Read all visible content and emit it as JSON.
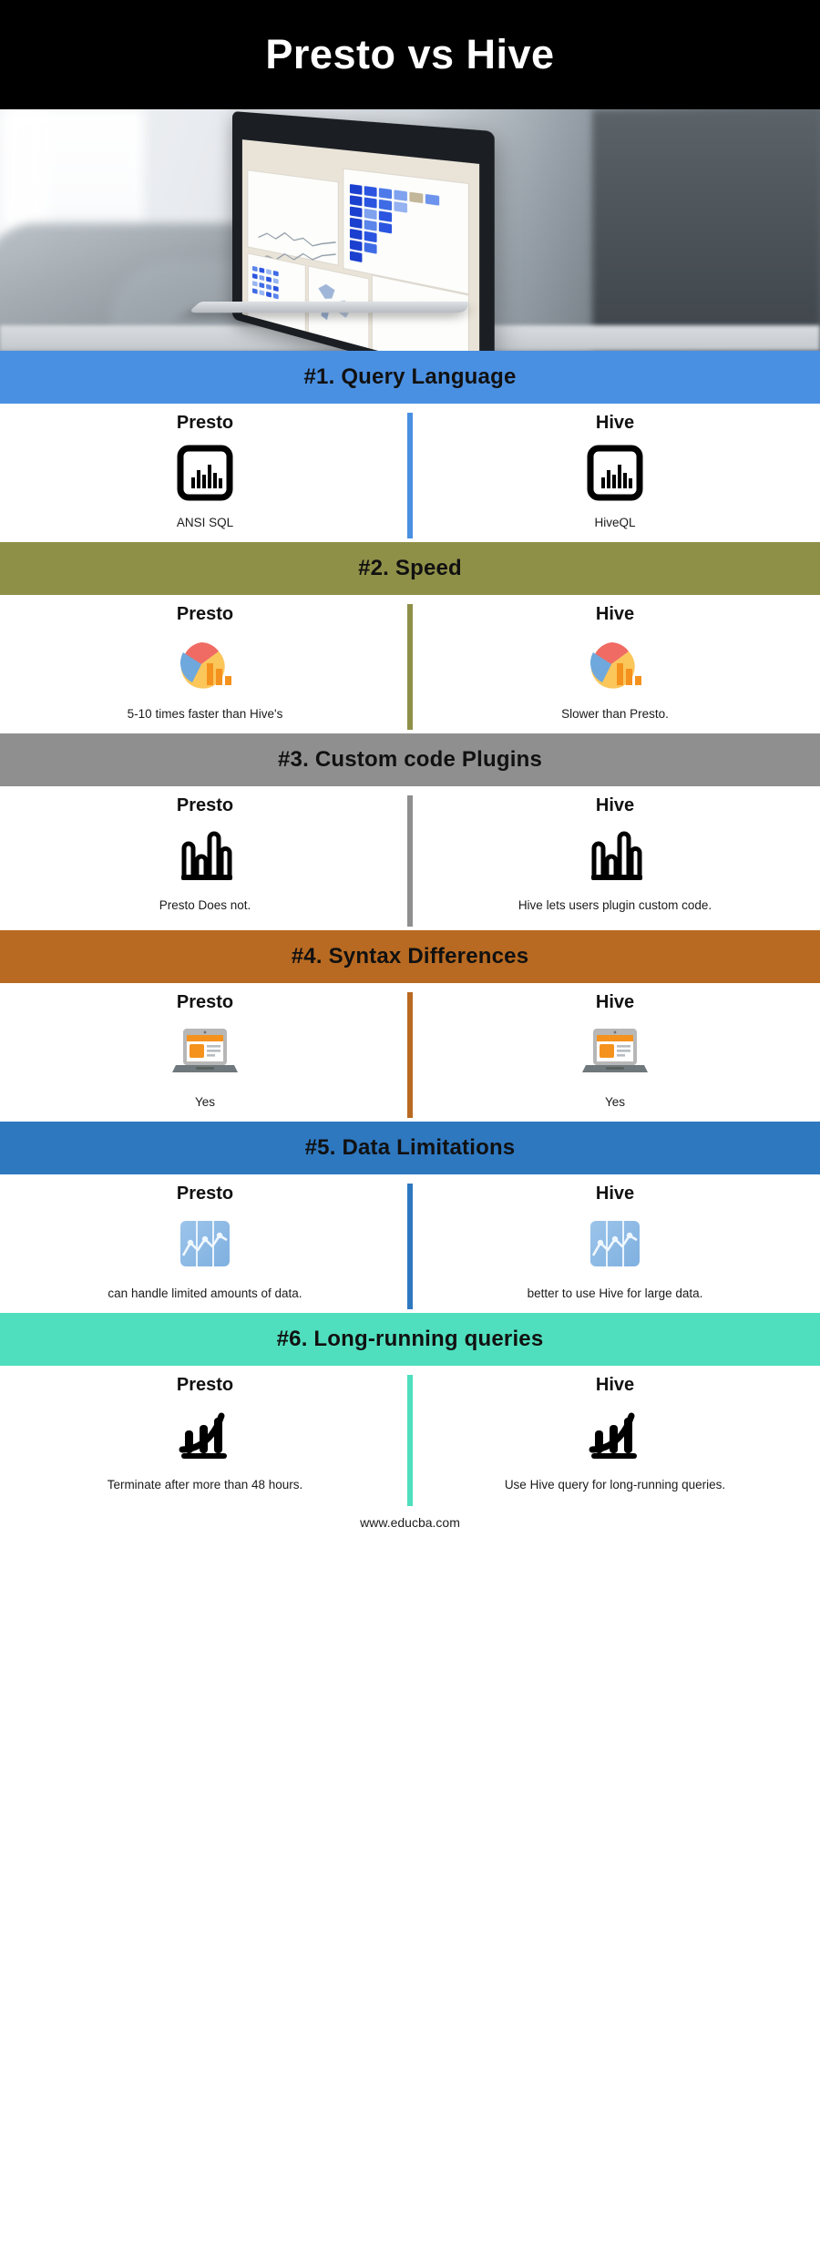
{
  "header": {
    "title": "Presto vs Hive",
    "background": "#000000",
    "text_color": "#ffffff"
  },
  "hero": {
    "alt": "laptop-analytics-dashboard-photo"
  },
  "columns": {
    "left_name": "Presto",
    "right_name": "Hive"
  },
  "footer": {
    "url": "www.educba.com"
  },
  "sections": [
    {
      "banner": "#1. Query Language",
      "color": "#4a90e2",
      "icon": "bar-chart-framed-icon",
      "left": {
        "name": "Presto",
        "caption": "ANSI SQL"
      },
      "right": {
        "name": "Hive",
        "caption": "HiveQL"
      }
    },
    {
      "banner": "#2. Speed",
      "color": "#8f9048",
      "icon": "pie-chart-bars-icon",
      "left": {
        "name": "Presto",
        "caption": "5-10 times faster than Hive's"
      },
      "right": {
        "name": "Hive",
        "caption": "Slower than Presto."
      }
    },
    {
      "banner": "#3. Custom code Plugins",
      "color": "#8f8f8f",
      "icon": "bar-chart-outline-icon",
      "left": {
        "name": "Presto",
        "caption": "Presto Does not."
      },
      "right": {
        "name": "Hive",
        "caption": "Hive lets users plugin custom code."
      }
    },
    {
      "banner": "#4. Syntax Differences",
      "color": "#b86a22",
      "icon": "laptop-browser-icon",
      "left": {
        "name": "Presto",
        "caption": "Yes"
      },
      "right": {
        "name": "Hive",
        "caption": "Yes"
      }
    },
    {
      "banner": "#5. Data Limitations",
      "color": "#2e78c0",
      "icon": "line-chart-tile-icon",
      "left": {
        "name": "Presto",
        "caption": "can handle limited amounts of data."
      },
      "right": {
        "name": "Hive",
        "caption": "better to use Hive for large data."
      }
    },
    {
      "banner": "#6. Long-running queries",
      "color": "#4fdfbe",
      "icon": "growth-chart-icon",
      "left": {
        "name": "Presto",
        "caption": "Terminate after more than 48 hours."
      },
      "right": {
        "name": "Hive",
        "caption": "Use Hive query for long-running queries."
      }
    }
  ]
}
